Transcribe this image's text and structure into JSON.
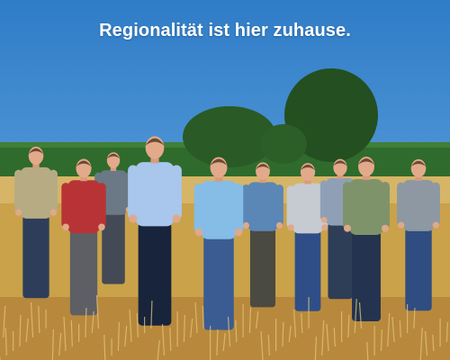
{
  "headline": "Regionalität ist hier zuhause.",
  "colors": {
    "sky_top": "#2f7cc7",
    "sky_bottom": "#d8e7ee",
    "field": "#c9a24a",
    "corn": "#2f6b2c",
    "trees": "#2a5a25",
    "text": "#ffffff"
  },
  "people": [
    {
      "shirt": "#b7ab84",
      "pants": "#2e3e5a"
    },
    {
      "shirt": "#b83336",
      "pants": "#5d5f64"
    },
    {
      "shirt": "#6b7886",
      "pants": "#444a55"
    },
    {
      "shirt": "#a9c6ec",
      "pants": "#18243c"
    },
    {
      "shirt": "#85bde6",
      "pants": "#3b5c93"
    },
    {
      "shirt": "#5a87b6",
      "pants": "#4b4a42"
    },
    {
      "shirt": "#c6cad1",
      "pants": "#2f4e88"
    },
    {
      "shirt": "#8fa0b6",
      "pants": "#2e3e56"
    },
    {
      "shirt": "#7f936b",
      "pants": "#24334f"
    },
    {
      "shirt": "#8d98a3",
      "pants": "#2f4d80"
    }
  ]
}
